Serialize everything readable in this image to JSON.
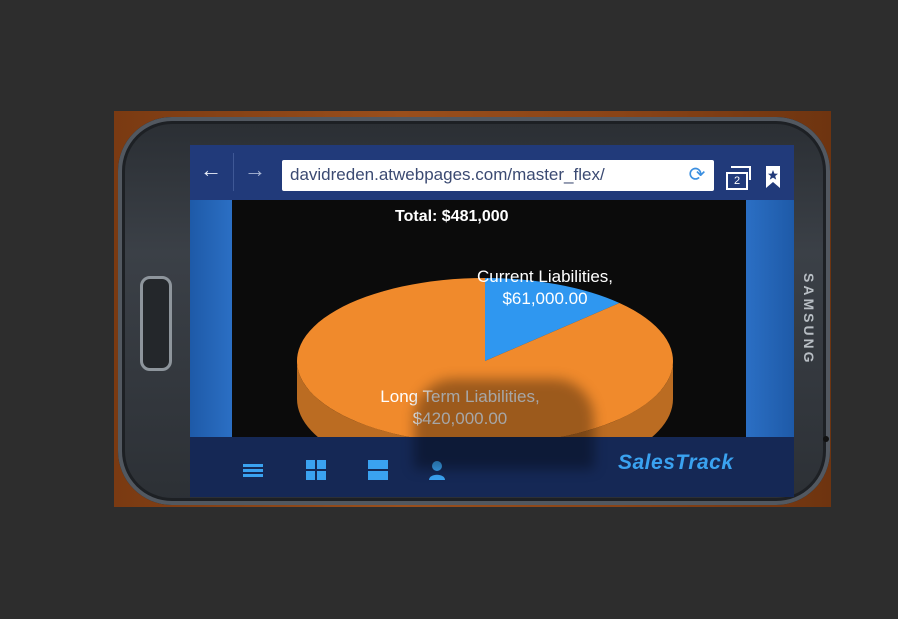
{
  "browser": {
    "url": "davidreden.atwebpages.com/master_flex/",
    "tab_count": "2",
    "back_label": "←",
    "forward_label": "→",
    "refresh_label": "⟳"
  },
  "chart_data": {
    "type": "pie",
    "title": "Total: $481,000",
    "slices": [
      {
        "label": "Current Liabilities,",
        "value_label": "$61,000.00",
        "value": 61000,
        "color": "#2f97f0"
      },
      {
        "label": "Long Term Liabilities,",
        "value_label": "$420,000.00",
        "value": 420000,
        "color": "#f08a2c"
      }
    ]
  },
  "app_bar": {
    "brand": "SalesTrack",
    "icons": [
      "list-icon",
      "grid-icon",
      "tiles-icon",
      "user-icon"
    ]
  },
  "device": {
    "brand": "SAMSUNG"
  },
  "colors": {
    "accent": "#3aa2f0",
    "browser_bar": "#213a7a",
    "bottom_bar": "#152855"
  }
}
